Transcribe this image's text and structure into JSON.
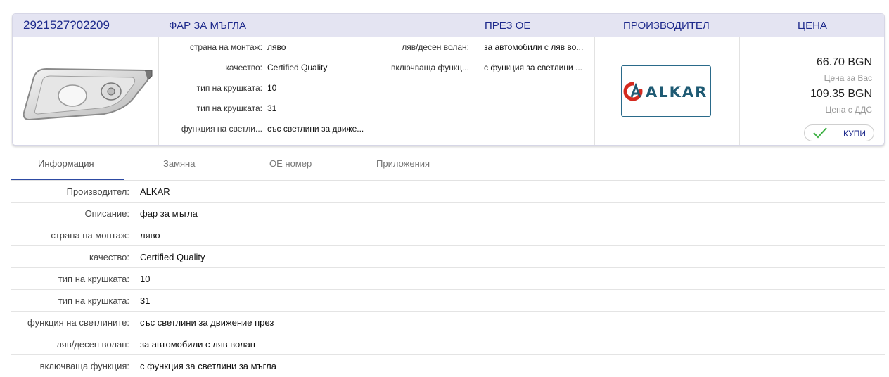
{
  "header": {
    "part_number": "2921527?02209",
    "title": "ФАР ЗА МЪГЛА",
    "oe_label": "ПРЕЗ ОЕ",
    "manufacturer_label": "ПРОИЗВОДИТЕЛ",
    "price_label": "ЦЕНА"
  },
  "specs_left": [
    {
      "key": "страна на монтаж:",
      "value": "ляво"
    },
    {
      "key": "качество:",
      "value": "Certified Quality"
    },
    {
      "key": "тип на крушката:",
      "value": "10"
    },
    {
      "key": "тип на крушката:",
      "value": "31"
    },
    {
      "key": "функция на светли...",
      "value": "със светлини за движе..."
    }
  ],
  "specs_right": [
    {
      "key": "ляв/десен волан:",
      "value": "за автомобили с ляв во..."
    },
    {
      "key": "включваща функц...",
      "value": "с функция за светлини ..."
    }
  ],
  "manufacturer_logo": {
    "text": "ALKAR",
    "color": "#1e5a73",
    "mark_color": "#d42a1f"
  },
  "price": {
    "net": "66.70 BGN",
    "net_label": "Цена за Вас",
    "gross": "109.35 BGN",
    "gross_label": "Цена с ДДС",
    "buy_label": "КУПИ",
    "buy_icon": "check-icon",
    "check_color": "#3cb043"
  },
  "tabs": [
    {
      "label": "Информация",
      "active": true
    },
    {
      "label": "Замяна",
      "active": false
    },
    {
      "label": "ОЕ номер",
      "active": false
    },
    {
      "label": "Приложения",
      "active": false
    }
  ],
  "info": [
    {
      "key": "Производител:",
      "value": "ALKAR"
    },
    {
      "key": "Описание:",
      "value": "фар за мъгла"
    },
    {
      "key": "страна на монтаж:",
      "value": "ляво"
    },
    {
      "key": "качество:",
      "value": "Certified Quality"
    },
    {
      "key": "тип на крушката:",
      "value": "10"
    },
    {
      "key": "тип на крушката:",
      "value": "31"
    },
    {
      "key": "функция на светлините:",
      "value": "със светлини за движение през"
    },
    {
      "key": "ляв/десен волан:",
      "value": "за автомобили с ляв волан"
    },
    {
      "key": "включваща функция:",
      "value": "с функция за светлини за мъгла"
    }
  ],
  "accent": "#2d4aa3"
}
